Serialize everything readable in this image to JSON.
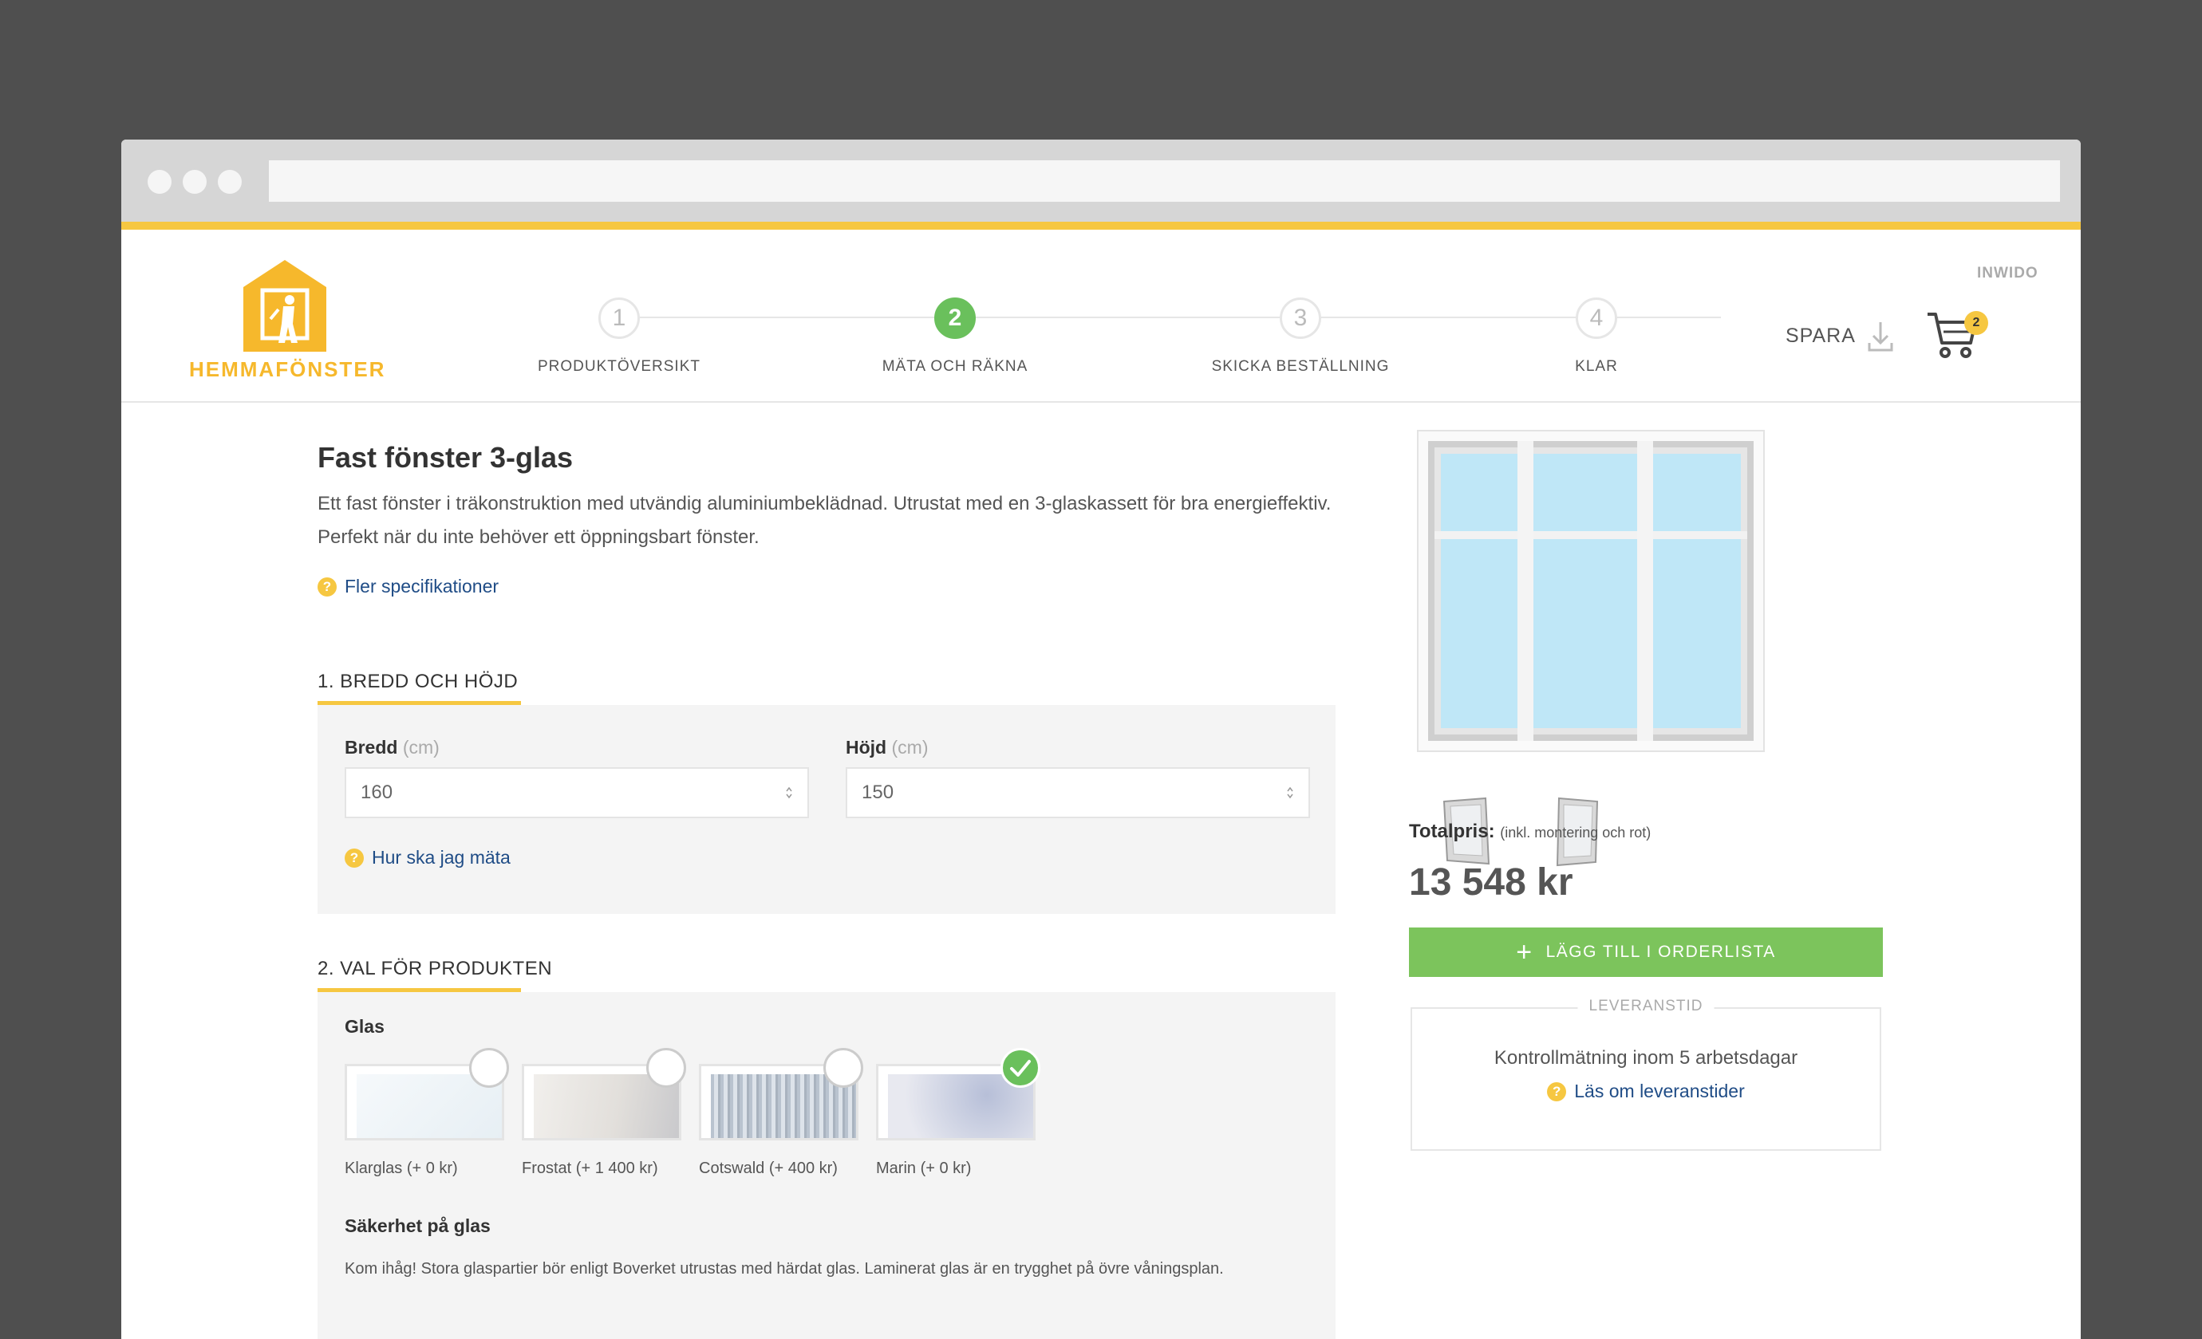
{
  "header": {
    "brand": "HEMMAFÖNSTER",
    "partner": "INWIDO",
    "steps": [
      {
        "number": "1",
        "label": "PRODUKTÖVERSIKT"
      },
      {
        "number": "2",
        "label": "MÄTA OCH RÄKNA"
      },
      {
        "number": "3",
        "label": "SKICKA BESTÄLLNING"
      },
      {
        "number": "4",
        "label": "KLAR"
      }
    ],
    "save_label": "SPARA",
    "cart_count": "2"
  },
  "product": {
    "title": "Fast fönster 3-glas",
    "description": "Ett fast fönster i träkonstruktion med utvändig aluminiumbeklädnad. Utrustat med en 3-glaskassett för bra energieffektiv. Perfekt när du inte behöver ett öppningsbart fönster.",
    "spec_link": "Fler specifikationer"
  },
  "section1": {
    "title": "1. BREDD OCH HÖJD",
    "width_label": "Bredd",
    "height_label": "Höjd",
    "unit": "(cm)",
    "width_value": "160",
    "height_value": "150",
    "help_link": "Hur ska jag mäta"
  },
  "section2": {
    "title": "2. VAL FÖR PRODUKTEN",
    "glass_label": "Glas",
    "glass_options": [
      {
        "name": "Klarglas (+ 0 kr)",
        "selected": false
      },
      {
        "name": "Frostat (+ 1 400 kr)",
        "selected": false
      },
      {
        "name": "Cotswald (+ 400 kr)",
        "selected": false
      },
      {
        "name": "Marin (+ 0 kr)",
        "selected": true
      }
    ],
    "safety_title": "Säkerhet på glas",
    "safety_text": "Kom ihåg! Stora glaspartier bör enligt Boverket utrustas med härdat glas. Laminerat glas är en trygghet på övre våningsplan."
  },
  "sidebar": {
    "total_label": "Totalpris:",
    "total_note": "(inkl. montering och rot)",
    "total_price": "13 548 kr",
    "add_button": "LÄGG TILL I ORDERLISTA",
    "delivery_legend": "LEVERANSTID",
    "delivery_text": "Kontrollmätning inom 5 arbetsdagar",
    "delivery_link": "Läs om leveranstider"
  },
  "colors": {
    "accent_yellow": "#f6c741",
    "active_green": "#6ac05c",
    "button_green": "#7cc45c",
    "link_blue": "#1f4c86",
    "glass_blue": "#bfe7f7"
  },
  "help_icon_glyph": "?"
}
